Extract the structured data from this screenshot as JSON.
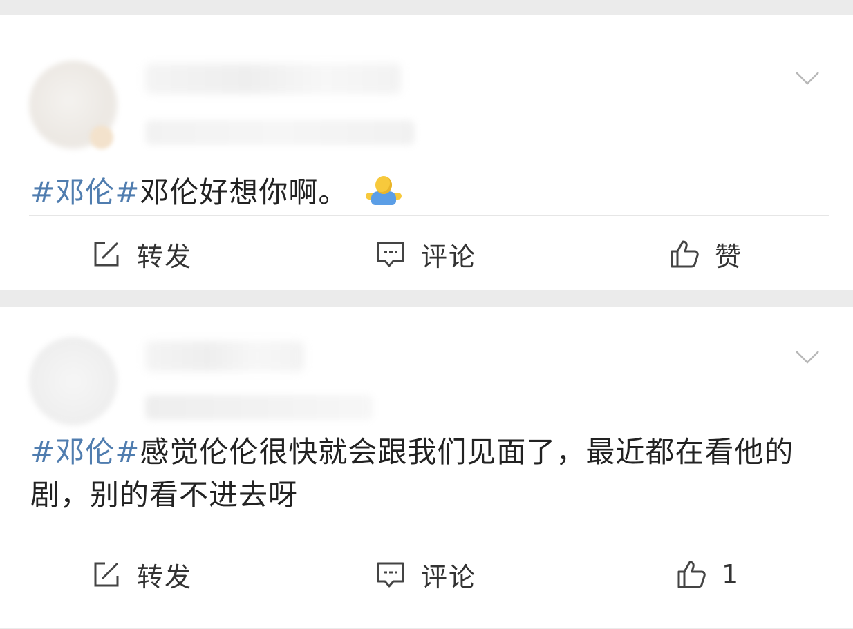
{
  "posts": [
    {
      "content": {
        "topic": "#邓伦#",
        "text": "邓伦好想你啊。"
      },
      "emoji_icon": "shrug-person-emoji",
      "actions": {
        "repost_label": "转发",
        "comment_label": "评论",
        "like_label": "赞"
      }
    },
    {
      "content": {
        "topic": "#邓伦#",
        "text": "感觉伦伦很快就会跟我们见面了，最近都在看他的剧，别的看不进去呀"
      },
      "actions": {
        "repost_label": "转发",
        "comment_label": "评论",
        "like_label": "1"
      }
    }
  ],
  "colors": {
    "topic": "#507daf",
    "text": "#222222",
    "icon": "#444444",
    "background": "#ebebeb",
    "card": "#ffffff"
  }
}
